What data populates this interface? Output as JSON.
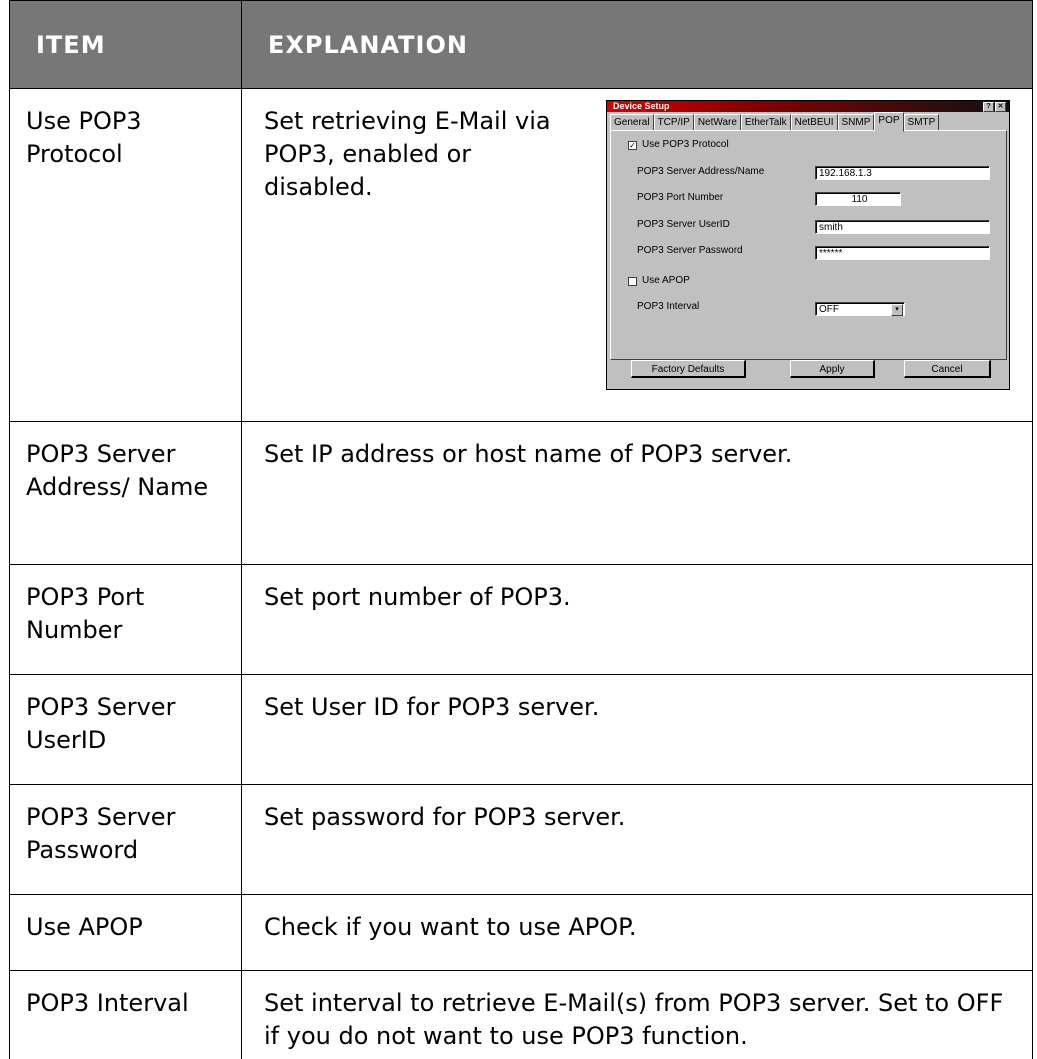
{
  "table": {
    "header": {
      "item": "ITEM",
      "explanation": "EXPLANATION"
    },
    "rows": [
      {
        "item": "Use POP3 Protocol",
        "explanation": "Set retrieving E-Mail via POP3, enabled or disabled."
      },
      {
        "item": "POP3 Server Address/ Name",
        "explanation": "Set IP address or host name of POP3 server."
      },
      {
        "item": "POP3 Port Number",
        "explanation": "Set port number of POP3."
      },
      {
        "item": "POP3 Server UserID",
        "explanation": "Set User ID for POP3 server."
      },
      {
        "item": "POP3 Server Password",
        "explanation": "Set password for POP3 server."
      },
      {
        "item": "Use APOP",
        "explanation": "Check if you want to use APOP."
      },
      {
        "item": "POP3 Interval",
        "explanation": "Set interval to retrieve E-Mail(s) from POP3 server. Set to OFF if you do not want to use POP3 function."
      }
    ]
  },
  "dialog": {
    "title": "Device Setup",
    "help_glyph": "?",
    "close_glyph": "✕",
    "tabs": [
      "General",
      "TCP/IP",
      "NetWare",
      "EtherTalk",
      "NetBEUI",
      "SNMP",
      "POP",
      "SMTP"
    ],
    "active_tab": "POP",
    "use_pop3_label": "Use POP3 Protocol",
    "use_pop3_checked": true,
    "check_mark": "✓",
    "server_address_label": "POP3 Server Address/Name",
    "server_address_value": "192.168.1.3",
    "port_label": "POP3 Port Number",
    "port_value": "110",
    "userid_label": "POP3 Server UserID",
    "userid_value": "smith",
    "password_label": "POP3 Server Password",
    "password_value": "******",
    "use_apop_label": "Use APOP",
    "use_apop_checked": false,
    "interval_label": "POP3 Interval",
    "interval_value": "OFF",
    "dropdown_glyph": "▾",
    "buttons": {
      "factory_defaults": "Factory Defaults",
      "apply": "Apply",
      "cancel": "Cancel"
    }
  }
}
